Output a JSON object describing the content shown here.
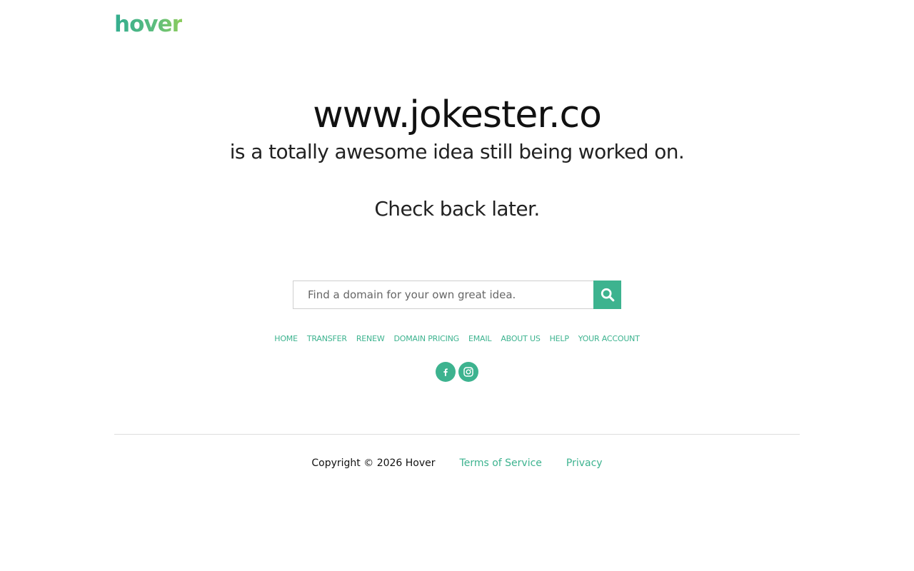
{
  "brand": {
    "logo_text": "hover",
    "accent_color": "#3db38f"
  },
  "hero": {
    "domain": "www.jokester.co",
    "tagline": "is a totally awesome idea still being worked on.",
    "check_back": "Check back later."
  },
  "search": {
    "placeholder": "Find a domain for your own great idea.",
    "value": "",
    "button_icon": "search-icon"
  },
  "nav": {
    "items": [
      {
        "label": "HOME"
      },
      {
        "label": "TRANSFER"
      },
      {
        "label": "RENEW"
      },
      {
        "label": "DOMAIN PRICING"
      },
      {
        "label": "EMAIL"
      },
      {
        "label": "ABOUT US"
      },
      {
        "label": "HELP"
      },
      {
        "label": "YOUR ACCOUNT"
      }
    ]
  },
  "social": {
    "icons": [
      "facebook-icon",
      "instagram-icon"
    ]
  },
  "footer": {
    "copyright": "Copyright © 2026 Hover",
    "terms_label": "Terms of Service",
    "privacy_label": "Privacy"
  }
}
